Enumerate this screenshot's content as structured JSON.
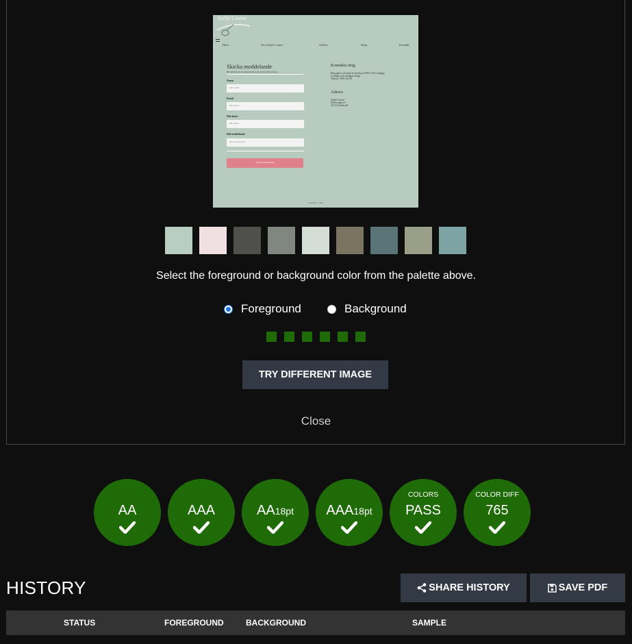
{
  "preview": {
    "logo": "Ateljé Louise",
    "nav": [
      "Hem",
      "Om Ateljé Louise",
      "Galleri",
      "Shop",
      "Kontakt"
    ],
    "form_title": "Skicka meddelande",
    "form_sub": "Hit skickar du ett meddelande om du har någon fråga",
    "fields": [
      {
        "label": "Namn",
        "placeholder": "Ditt namn"
      },
      {
        "label": "Email",
        "placeholder": "Din email"
      },
      {
        "label": "Ditt ämne",
        "placeholder": "Ditt ämne"
      },
      {
        "label": "Ditt meddelande",
        "placeholder": "Ditt meddelande"
      }
    ],
    "submit": "Skicka meddelande",
    "contact_title": "Kontakta mig",
    "contact_lines": [
      "Ring gärna och boka ett besök på 0708-12 00 vardagar",
      "Lördagar och söndagar stängt",
      "Telefon: 0708-123 00"
    ],
    "address_title": "Adress",
    "address_lines": [
      "Ateljé Louise",
      "Klövervägen 9",
      "433 34 Sundsvall"
    ],
    "copyright": "Copyright © 2022"
  },
  "palette": [
    "#b8cec2",
    "#f0e0e2",
    "#4f4f4b",
    "#808680",
    "#d5ddd7",
    "#7a7560",
    "#5b7478",
    "#9a9f88",
    "#7ea3a4"
  ],
  "instructions": "Select the foreground or background color from the palette above.",
  "radios": {
    "foreground": "Foreground",
    "background": "Background",
    "selected": "foreground"
  },
  "selected_slots_color": "#1f6b07",
  "buttons": {
    "try_different": "TRY DIFFERENT IMAGE",
    "close": "Close",
    "share_history": "SHARE HISTORY",
    "save_pdf": "SAVE PDF"
  },
  "results": [
    {
      "top": "",
      "main": "AA",
      "suffix": "",
      "pass": true
    },
    {
      "top": "",
      "main": "AAA",
      "suffix": "",
      "pass": true
    },
    {
      "top": "",
      "main": "AA",
      "suffix": "18pt",
      "pass": true
    },
    {
      "top": "",
      "main": "AAA",
      "suffix": "18pt",
      "pass": true
    },
    {
      "top": "COLORS",
      "main": "PASS",
      "suffix": "",
      "pass": true
    },
    {
      "top": "COLOR DIFF",
      "main": "765",
      "suffix": "",
      "pass": true
    }
  ],
  "history": {
    "title": "HISTORY",
    "columns": [
      "STATUS",
      "FOREGROUND",
      "BACKGROUND",
      "SAMPLE"
    ]
  },
  "colors": {
    "badge": "#1f6b07",
    "button": "#343a45",
    "background": "#0f0f0f"
  }
}
